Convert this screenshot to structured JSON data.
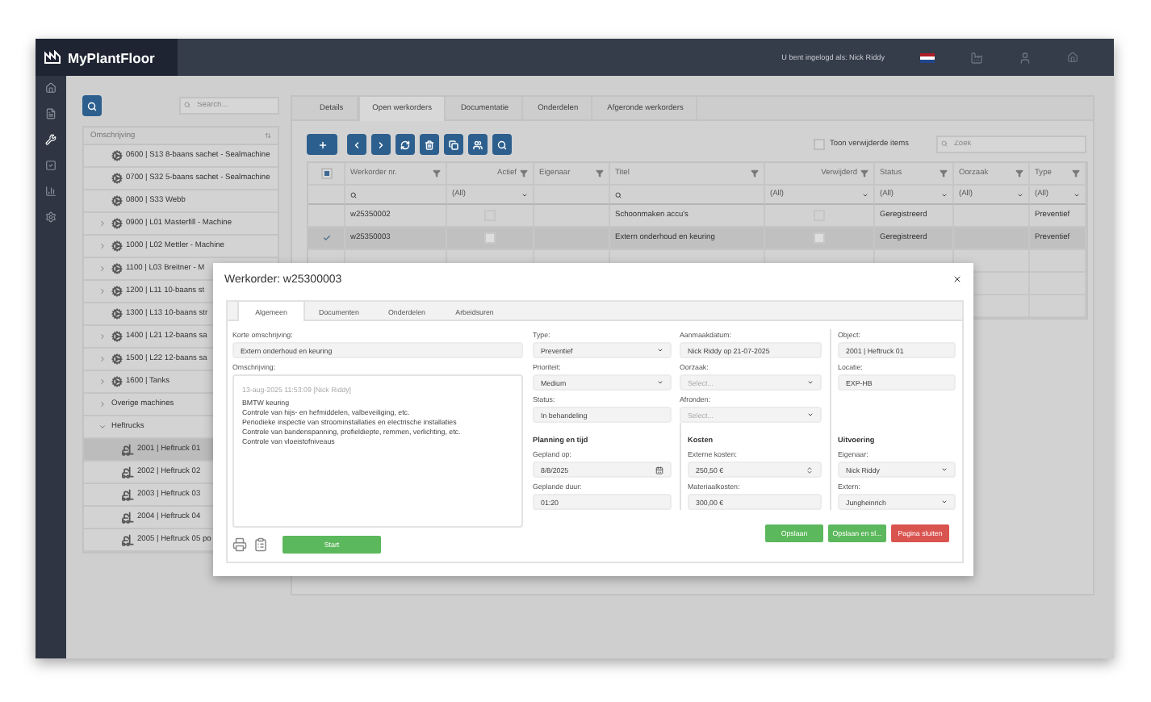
{
  "app": {
    "name": "MyPlantFloor",
    "login_text": "U bent ingelogd als: Nick Riddy"
  },
  "sidebar": {
    "items": [
      {
        "selected": false
      },
      {
        "selected": false
      },
      {
        "selected": true
      },
      {
        "selected": false
      },
      {
        "selected": false
      },
      {
        "selected": false
      }
    ]
  },
  "tree": {
    "search_placeholder": "Search...",
    "header": "Omschrijving",
    "items": [
      {
        "label": "0600 | S13 8-baans sachet - Sealmachine",
        "kind": "machine",
        "selected": false
      },
      {
        "label": "0700 | S32 5-baans sachet - Sealmachine",
        "kind": "machine",
        "selected": false
      },
      {
        "label": "0800 | S33 Webb",
        "kind": "machine",
        "selected": false
      },
      {
        "label": "0900 | L01 Masterfill - Machine",
        "kind": "machine",
        "selected": false,
        "expanded": false
      },
      {
        "label": "1000 | L02 Mettler - Machine",
        "kind": "machine",
        "selected": false,
        "expanded": false
      },
      {
        "label": "1100 | L03 Breitner - M",
        "kind": "machine",
        "selected": false,
        "expanded": false
      },
      {
        "label": "1200 | L11 10-baans st",
        "kind": "machine",
        "selected": false,
        "expanded": false
      },
      {
        "label": "1300 | L13 10-baans str",
        "kind": "machine",
        "selected": false
      },
      {
        "label": "1400 | L21 12-baans sa",
        "kind": "machine",
        "selected": false,
        "expanded": false
      },
      {
        "label": "1500 | L22 12-baans sa",
        "kind": "machine",
        "selected": false,
        "expanded": false
      },
      {
        "label": "1600 | Tanks",
        "kind": "machine",
        "selected": false,
        "expanded": false
      },
      {
        "label": "Overige machines",
        "kind": "group",
        "selected": false,
        "expanded": false
      },
      {
        "label": "Heftrucks",
        "kind": "group",
        "selected": false,
        "expanded": true,
        "children": [
          {
            "label": "2001 | Heftruck 01",
            "kind": "forklift",
            "selected": true
          },
          {
            "label": "2002 | Heftruck 02",
            "kind": "forklift",
            "selected": false
          },
          {
            "label": "2003 | Heftruck 03",
            "kind": "forklift",
            "selected": false
          },
          {
            "label": "2004 | Heftruck 04",
            "kind": "forklift",
            "selected": false
          },
          {
            "label": "2005 | Heftruck 05 po",
            "kind": "forklift",
            "selected": false
          }
        ]
      }
    ]
  },
  "tabs": [
    {
      "label": "Details",
      "selected": false
    },
    {
      "label": "Open werkorders",
      "selected": true
    },
    {
      "label": "Documentatie",
      "selected": false
    },
    {
      "label": "Onderdelen",
      "selected": false
    },
    {
      "label": "Afgeronde werkorders",
      "selected": false
    }
  ],
  "toolbar": {
    "show_deleted": {
      "label": "Toon verwijderde items",
      "checked": false
    },
    "search_placeholder": "Zoek"
  },
  "grid": {
    "select_all_partial": true,
    "columns": [
      {
        "label": "Werkorder nr.",
        "kind": "text"
      },
      {
        "label": "Actief",
        "kind": "check",
        "filter_value": "(All)"
      },
      {
        "label": "Eigenaar",
        "kind": "plain"
      },
      {
        "label": "Titel",
        "kind": "text"
      },
      {
        "label": "Verwijderd",
        "kind": "check",
        "filter_value": "(All)"
      },
      {
        "label": "Status",
        "kind": "choice",
        "filter_value": "(All)"
      },
      {
        "label": "Oorzaak",
        "kind": "choice",
        "filter_value": "(All)"
      },
      {
        "label": "Type",
        "kind": "choice",
        "filter_value": "(All)"
      }
    ],
    "rows": [
      {
        "selected": false,
        "werkorder": "w25350002",
        "actief": false,
        "titel": "Schoonmaken accu's",
        "verwijderd": false,
        "status": "Geregistreerd",
        "type": "Preventief"
      },
      {
        "selected": true,
        "werkorder": "w25350003",
        "actief": false,
        "titel": "Extern onderhoud en keuring",
        "verwijderd": false,
        "status": "Geregistreerd",
        "type": "Preventief"
      }
    ]
  },
  "modal": {
    "title": "Werkorder: w25300003",
    "tabs": [
      {
        "label": "Algemeen",
        "selected": true
      },
      {
        "label": "Documenten",
        "selected": false
      },
      {
        "label": "Onderdelen",
        "selected": false
      },
      {
        "label": "Arbeidsuren",
        "selected": false
      }
    ],
    "short_description": {
      "label": "Korte omschrijving:",
      "value": "Extern onderhoud en keuring"
    },
    "description": {
      "label": "Omschrijving:",
      "meta": "13-aug-2025 11:53:09 [Nick Riddy]",
      "lines": [
        "BMTW keuring",
        "Controle van hijs- en hefmiddelen, valbeveiliging, etc.",
        "Periodieke inspectie van stroominstallaties en electrische installaties",
        "Controle van bandenspanning, profieldiepte, remmen, verlichting, etc.",
        "Controle van vloeistofniveaus"
      ]
    },
    "start_button": "Start",
    "columns": [
      [
        {
          "label": "Type:",
          "value": "Preventief",
          "kind": "select"
        },
        {
          "label": "Prioriteit:",
          "value": "Medium",
          "kind": "select"
        },
        {
          "label": "Status:",
          "value": "In behandeling",
          "kind": "text"
        }
      ],
      [
        {
          "label": "Aanmaakdatum:",
          "value": "Nick Riddy op 21-07-2025",
          "kind": "text"
        },
        {
          "label": "Oorzaak:",
          "placeholder": "Select...",
          "kind": "select"
        },
        {
          "label": "Afronden:",
          "placeholder": "Select...",
          "kind": "select"
        }
      ],
      [
        {
          "label": "Object:",
          "value": "2001 | Heftruck 01",
          "kind": "text"
        },
        {
          "label": "Locatie:",
          "value": "EXP-HB",
          "kind": "text"
        }
      ]
    ],
    "sections": [
      {
        "title": "Planning en tijd",
        "fields": [
          {
            "label": "Gepland op:",
            "value": "8/8/2025",
            "kind": "date"
          },
          {
            "label": "Geplande duur:",
            "value": "01:20",
            "kind": "text"
          }
        ]
      },
      {
        "title": "Kosten",
        "fields": [
          {
            "label": "Externe kosten:",
            "value": "250,50 €",
            "kind": "number"
          },
          {
            "label": "Materiaalkosten:",
            "value": "300,00 €",
            "kind": "text"
          }
        ]
      },
      {
        "title": "Uitvoering",
        "fields": [
          {
            "label": "Eigenaar:",
            "value": "Nick Riddy",
            "kind": "select"
          },
          {
            "label": "Extern:",
            "value": "Jungheinrich",
            "kind": "select"
          }
        ]
      }
    ],
    "buttons": [
      {
        "label": "Opslaan",
        "kind": "success"
      },
      {
        "label": "Opslaan en sl...",
        "kind": "success"
      },
      {
        "label": "Pagina sluiten",
        "kind": "danger"
      }
    ]
  }
}
